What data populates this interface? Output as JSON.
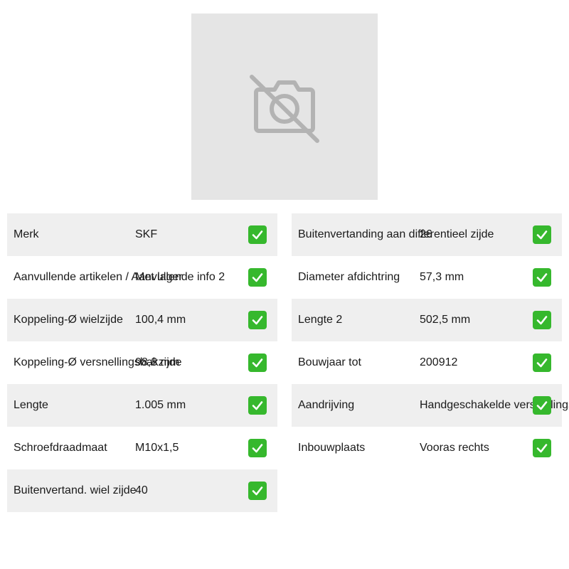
{
  "product_image": {
    "icon": "camera-off-icon"
  },
  "colors": {
    "row_shade": "#efefef",
    "check_green": "#36b82d",
    "placeholder_bg": "#e5e5e5"
  },
  "left_specs": [
    {
      "label": "Merk",
      "value": "SKF",
      "verified": true
    },
    {
      "label": "Aanvullende artikelen / Aanvullende info 2",
      "value": "Met lager",
      "verified": true
    },
    {
      "label": "Koppeling-Ø wielzijde",
      "value": "100,4 mm",
      "verified": true
    },
    {
      "label": "Koppeling-Ø versnellingsbakzijde",
      "value": "98,8 mm",
      "verified": true
    },
    {
      "label": "Lengte",
      "value": "1.005 mm",
      "verified": true
    },
    {
      "label": "Schroefdraadmaat",
      "value": "M10x1,5",
      "verified": true
    },
    {
      "label": "Buitenvertand. wiel zijde",
      "value": "40",
      "verified": true
    }
  ],
  "right_specs": [
    {
      "label": "Buitenvertanding aan differentieel zijde",
      "value": "26",
      "verified": true
    },
    {
      "label": "Diameter afdichtring",
      "value": "57,3 mm",
      "verified": true
    },
    {
      "label": "Lengte 2",
      "value": "502,5 mm",
      "verified": true
    },
    {
      "label": "Bouwjaar tot",
      "value": "200912",
      "verified": true
    },
    {
      "label": "Aandrijving",
      "value": "Handgeschakelde versnellingsbak",
      "verified": true
    },
    {
      "label": "Inbouwplaats",
      "value": "Vooras rechts",
      "verified": true
    }
  ]
}
